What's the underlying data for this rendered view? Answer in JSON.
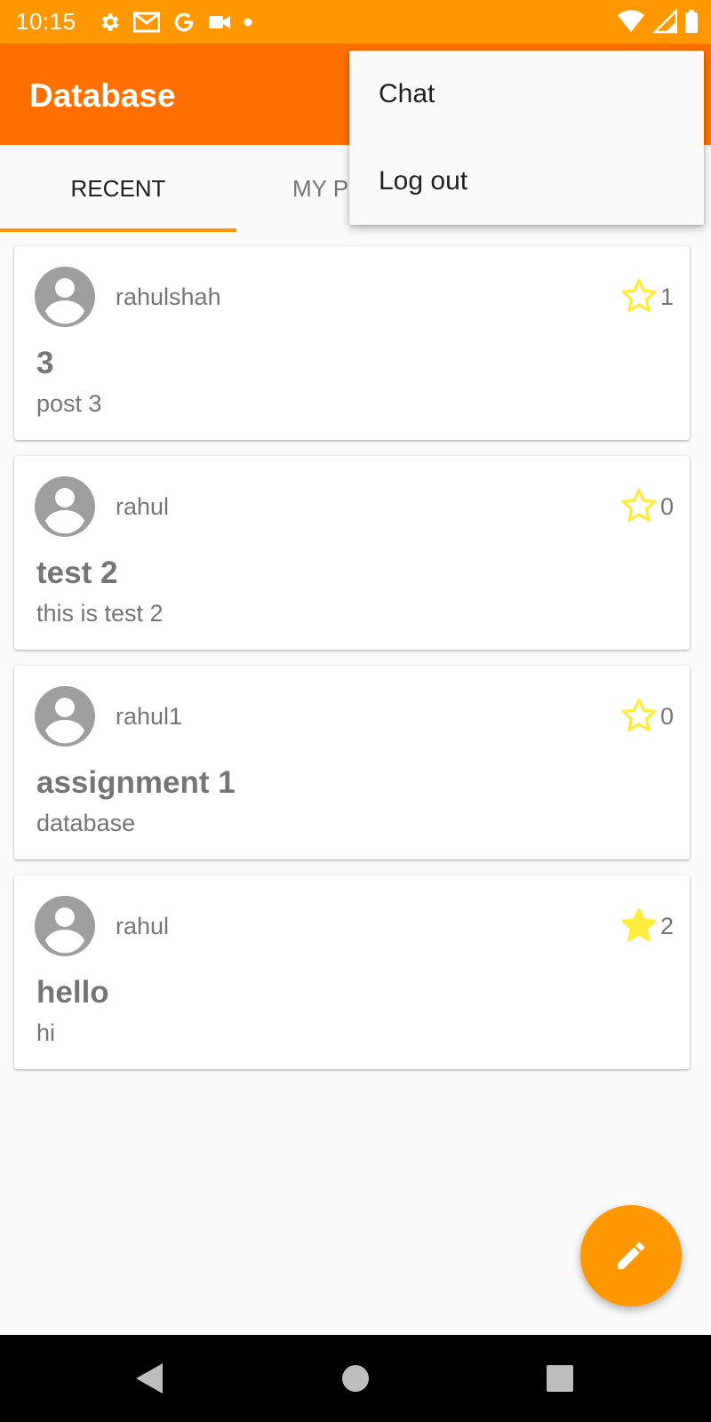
{
  "status_bar": {
    "time": "10:15",
    "left_icons": [
      "gear-icon",
      "gmail-icon",
      "google-icon",
      "video-icon",
      "dot-icon"
    ],
    "right_icons": [
      "wifi-icon",
      "signal-icon",
      "battery-icon"
    ]
  },
  "app_bar": {
    "title": "Database"
  },
  "tabs": [
    {
      "label": "RECENT",
      "active": true
    },
    {
      "label": "MY P",
      "active": false
    }
  ],
  "overflow_menu": {
    "items": [
      {
        "label": "Chat"
      },
      {
        "label": "Log out"
      }
    ]
  },
  "posts": [
    {
      "author": "rahulshah",
      "stars": "1",
      "starred": false,
      "title": "3",
      "body": "post 3"
    },
    {
      "author": "rahul",
      "stars": "0",
      "starred": false,
      "title": "test 2",
      "body": "this is test 2"
    },
    {
      "author": "rahul1",
      "stars": "0",
      "starred": false,
      "title": "assignment 1",
      "body": "database"
    },
    {
      "author": "rahul",
      "stars": "2",
      "starred": true,
      "title": "hello",
      "body": "hi"
    }
  ],
  "fab": {
    "icon": "pencil-icon"
  },
  "nav_bar": {
    "buttons": [
      "back-icon",
      "home-icon",
      "recents-icon"
    ]
  },
  "colors": {
    "status_bar": "#ff9800",
    "app_bar": "#ff6f00",
    "accent": "#ff9800",
    "star": "#ffeb3b"
  }
}
